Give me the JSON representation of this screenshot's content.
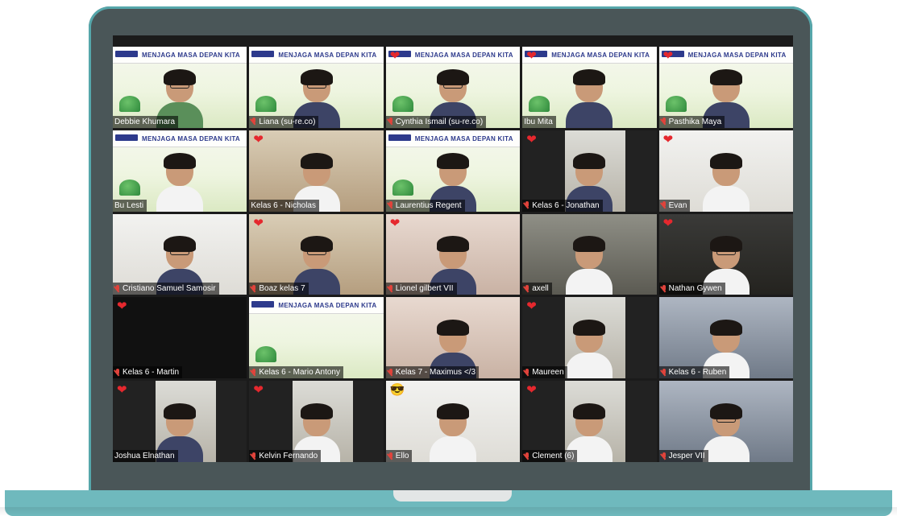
{
  "meeting": {
    "banner_title": "MENJAGA MASA DEPAN KITA",
    "participants": [
      {
        "name": "Debbie Khumara",
        "bg": "banner",
        "reaction": "",
        "muted": false,
        "active": true,
        "person": "green glasses"
      },
      {
        "name": "Liana (su-re.co)",
        "bg": "banner",
        "reaction": "",
        "muted": true,
        "active": false,
        "person": "dark glasses"
      },
      {
        "name": "Cynthia Ismail (su-re.co)",
        "bg": "banner",
        "reaction": "heart",
        "muted": true,
        "active": false,
        "person": "dark glasses"
      },
      {
        "name": "Ibu Mita",
        "bg": "banner",
        "reaction": "heart",
        "muted": false,
        "active": false,
        "person": "dark"
      },
      {
        "name": "Pasthika Maya",
        "bg": "banner",
        "reaction": "heart",
        "muted": true,
        "active": false,
        "person": "dark"
      },
      {
        "name": "Bu Lesti",
        "bg": "banner",
        "reaction": "",
        "muted": false,
        "active": false,
        "person": "white"
      },
      {
        "name": "Kelas 6 - Nicholas",
        "bg": "room-beige",
        "reaction": "heart",
        "muted": false,
        "active": false,
        "person": "white"
      },
      {
        "name": "Laurentius Regent",
        "bg": "banner",
        "reaction": "",
        "muted": true,
        "active": false,
        "person": "dark"
      },
      {
        "name": "Kelas 6 - Jonathan",
        "bg": "inset",
        "reaction": "heart",
        "muted": true,
        "active": false,
        "person": "dark"
      },
      {
        "name": "Evan",
        "bg": "room-white",
        "reaction": "heart",
        "muted": true,
        "active": false,
        "person": "white"
      },
      {
        "name": "Cristiano Samuel Samosir",
        "bg": "room-white",
        "reaction": "",
        "muted": true,
        "active": false,
        "person": "dark glasses"
      },
      {
        "name": "Boaz kelas 7",
        "bg": "room-beige",
        "reaction": "heart",
        "muted": true,
        "active": false,
        "person": "dark glasses"
      },
      {
        "name": "Lionel gilbert VII",
        "bg": "room-pink",
        "reaction": "heart",
        "muted": true,
        "active": false,
        "person": "dark"
      },
      {
        "name": "axell",
        "bg": "room-grey",
        "reaction": "",
        "muted": true,
        "active": false,
        "person": "white"
      },
      {
        "name": "Nathan Gywen",
        "bg": "room-dark",
        "reaction": "heart",
        "muted": true,
        "active": false,
        "person": "white glasses"
      },
      {
        "name": "Kelas 6 - Martin",
        "bg": "black",
        "reaction": "heart",
        "muted": true,
        "active": false,
        "person": "none"
      },
      {
        "name": "Kelas 6 - Mario Antony",
        "bg": "banner",
        "reaction": "",
        "muted": true,
        "active": false,
        "person": "none"
      },
      {
        "name": "Kelas 7 - Maximus </3",
        "bg": "room-pink",
        "reaction": "",
        "muted": true,
        "active": false,
        "person": "dark"
      },
      {
        "name": "Maureen",
        "bg": "inset",
        "reaction": "heart",
        "muted": true,
        "active": false,
        "person": "white"
      },
      {
        "name": "Kelas 6 - Ruben",
        "bg": "room-blue",
        "reaction": "",
        "muted": true,
        "active": false,
        "person": "white"
      },
      {
        "name": "Joshua Elnathan",
        "bg": "inset",
        "reaction": "heart",
        "muted": false,
        "active": false,
        "person": "dark"
      },
      {
        "name": "Kelvin Fernando",
        "bg": "inset",
        "reaction": "heart",
        "muted": true,
        "active": false,
        "person": "white"
      },
      {
        "name": "Ello",
        "bg": "room-white",
        "reaction": "sunglasses",
        "muted": true,
        "active": false,
        "person": "white"
      },
      {
        "name": "Clement (6)",
        "bg": "inset",
        "reaction": "heart",
        "muted": true,
        "active": false,
        "person": "white"
      },
      {
        "name": "Jesper VII",
        "bg": "room-blue",
        "reaction": "",
        "muted": true,
        "active": false,
        "person": "white glasses"
      }
    ]
  },
  "colors": {
    "frame": "#4a5658",
    "accent": "#6fb9bd",
    "heart": "#e5282e",
    "muted_mic": "#e0433b"
  }
}
